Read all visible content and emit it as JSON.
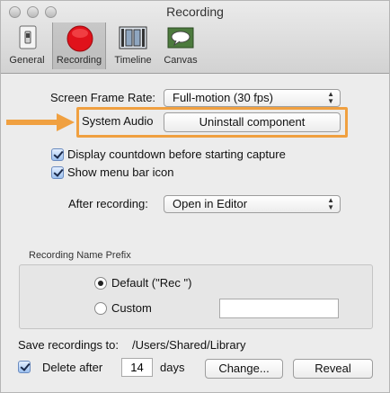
{
  "window": {
    "title": "Recording"
  },
  "toolbar": {
    "items": [
      {
        "label": "General"
      },
      {
        "label": "Recording"
      },
      {
        "label": "Timeline"
      },
      {
        "label": "Canvas"
      }
    ]
  },
  "form": {
    "frame_rate": {
      "label": "Screen Frame Rate:",
      "value": "Full-motion (30 fps)"
    },
    "system_audio": {
      "label": "System Audio",
      "button": "Uninstall component"
    },
    "countdown": {
      "label": "Display countdown before starting capture",
      "checked": true
    },
    "menu_bar_icon": {
      "label": "Show menu bar icon",
      "checked": true
    },
    "after_recording": {
      "label": "After recording:",
      "value": "Open in Editor"
    }
  },
  "name_prefix": {
    "title": "Recording Name Prefix",
    "default_option": "Default (\"Rec \")",
    "custom_option": "Custom",
    "custom_value": "",
    "selected": "default"
  },
  "save": {
    "label": "Save recordings to:",
    "path": "/Users/Shared/Library",
    "delete_after_label": "Delete after",
    "delete_after_checked": true,
    "days_value": "14",
    "days_label": "days",
    "change_button": "Change...",
    "reveal_button": "Reveal"
  },
  "colors": {
    "highlight": "#f0a040",
    "record_red": "#e0121b"
  }
}
